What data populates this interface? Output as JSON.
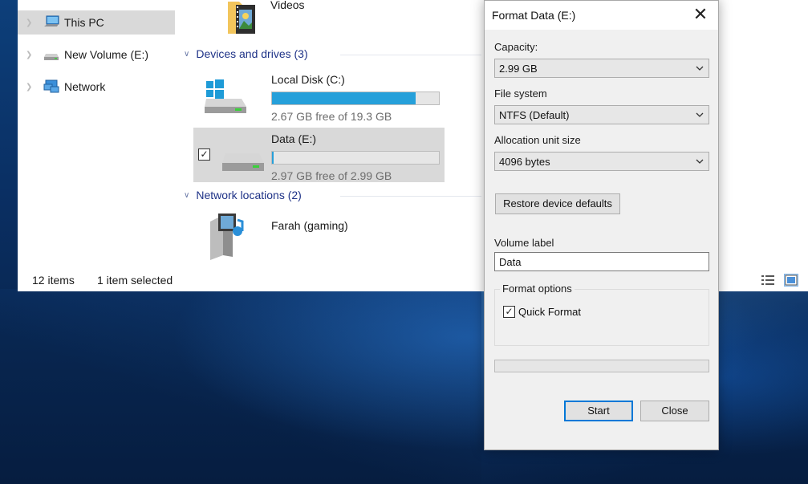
{
  "explorer": {
    "nav": {
      "items": [
        {
          "label": "This PC",
          "icon": "computer-icon",
          "selected": true
        },
        {
          "label": "New Volume (E:)",
          "icon": "drive-icon",
          "selected": false
        },
        {
          "label": "Network",
          "icon": "network-icon",
          "selected": false
        }
      ]
    },
    "content": {
      "folder_videos": {
        "label": "Videos",
        "icon": "videos-folder-icon"
      },
      "devices_header": "Devices and drives (3)",
      "drives": [
        {
          "name": "Local Disk (C:)",
          "free_text": "2.67 GB free of 19.3 GB",
          "used_fraction": 0.862,
          "icon": "windows-drive-icon",
          "selected": false
        },
        {
          "name": "Data (E:)",
          "free_text": "2.97 GB free of 2.99 GB",
          "used_fraction": 0.007,
          "icon": "drive-icon",
          "selected": true
        }
      ],
      "network_header": "Network locations (2)",
      "network_locations": [
        {
          "name": "Farah (gaming)",
          "icon": "media-server-icon"
        }
      ]
    },
    "status_bar": {
      "items_count": "12 items",
      "selection": "1 item selected"
    }
  },
  "format_dialog": {
    "title": "Format Data (E:)",
    "capacity_label": "Capacity:",
    "capacity_value": "2.99 GB",
    "file_system_label": "File system",
    "file_system_value": "NTFS (Default)",
    "allocation_label": "Allocation unit size",
    "allocation_value": "4096 bytes",
    "restore_defaults_label": "Restore device defaults",
    "volume_label_label": "Volume label",
    "volume_label_value": "Data",
    "format_options_label": "Format options",
    "quick_format_label": "Quick Format",
    "quick_format_checked": true,
    "progress_fraction": 0,
    "start_label": "Start",
    "close_label": "Close"
  },
  "colors": {
    "accent": "#0078d7",
    "drive_bar": "#26a0da",
    "group_header": "#1e3287",
    "selection": "#d9d9d9"
  }
}
